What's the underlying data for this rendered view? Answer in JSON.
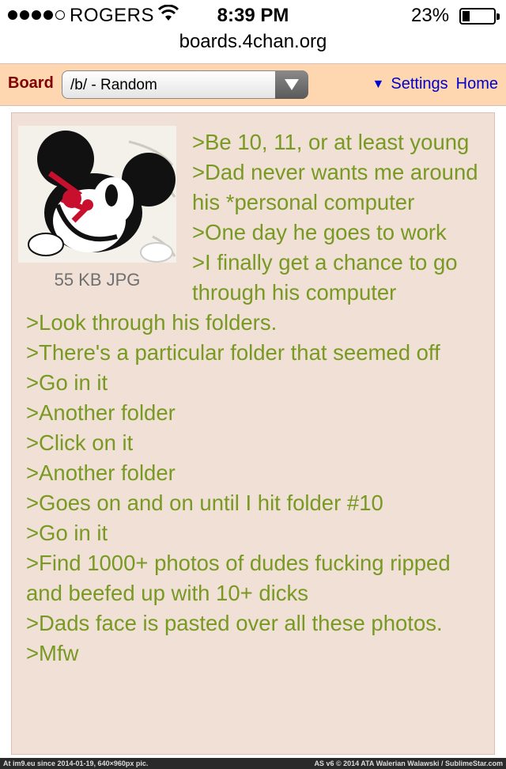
{
  "status_bar": {
    "carrier": "ROGERS",
    "time": "8:39 PM",
    "battery": "23%",
    "battery_level": 0.23
  },
  "browser": {
    "url": "boards.4chan.org"
  },
  "board_bar": {
    "label": "Board",
    "selected_board": "/b/ - Random",
    "settings_label": "Settings",
    "home_label": "Home",
    "colors": {
      "background": "#fed6af",
      "label": "#800000",
      "link": "#0000cc"
    }
  },
  "post": {
    "file_info": "55 KB JPG",
    "thumbnail": "mickey-mouse-injured-image",
    "lines": [
      ">Be 10, 11, or at least young",
      ">Dad never wants me around his *personal computer",
      ">One day he goes to work",
      ">I finally get a chance to go through his computer",
      ">Look through his folders.",
      ">There's a particular folder that seemed off",
      ">Go in it",
      ">Another folder",
      ">Click on it",
      ">Another folder",
      ">Goes on and on until I hit folder #10",
      ">Go in it",
      ">Find 1000+ photos of dudes fucking ripped and beefed up with 10+ dicks",
      ">Dads face is pasted over all these photos.",
      ">Mfw"
    ],
    "colors": {
      "background": "#f0e0d6",
      "greentext": "#789922"
    }
  },
  "footer": {
    "left": "At im9.eu since 2014-01-19, 640×960px pic.",
    "right": "AS v6 © 2014 ATA Walerian Walawski / SublimeStar.com"
  }
}
